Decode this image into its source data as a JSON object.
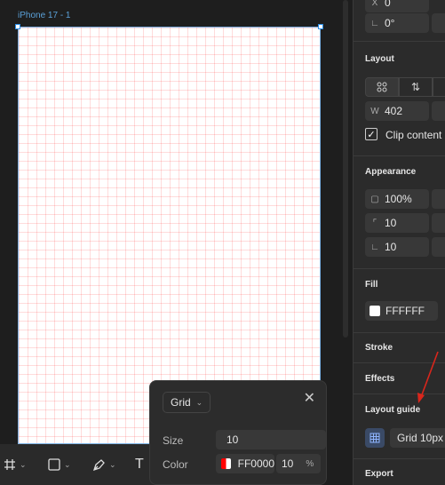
{
  "canvas": {
    "frame_label": "iPhone 17 - 1"
  },
  "toolbar": {
    "tools": [
      "frame-tool",
      "rectangle-tool",
      "pen-tool",
      "text-tool"
    ],
    "text_tool_glyph": "T"
  },
  "grid_popup": {
    "type_label": "Grid",
    "size_label": "Size",
    "size_value": "10",
    "color_label": "Color",
    "color_hex": "FF0000",
    "opacity_value": "10",
    "opacity_unit": "%",
    "grid_color": "#ff0000"
  },
  "panel": {
    "top": {
      "x_label": "X",
      "x_value": "0",
      "rotation_value": "0°"
    },
    "layout": {
      "title": "Layout",
      "width_label": "W",
      "width_value": "402",
      "clip_content_label": "Clip content",
      "clip_content_checked": true
    },
    "appearance": {
      "title": "Appearance",
      "opacity_value": "100%",
      "radius_value": "10",
      "radius_value_2": "10"
    },
    "fill": {
      "title": "Fill",
      "hex": "FFFFFF",
      "color": "#ffffff"
    },
    "stroke": {
      "title": "Stroke"
    },
    "effects": {
      "title": "Effects"
    },
    "layout_guide": {
      "title": "Layout guide",
      "item_label": "Grid 10px"
    },
    "export": {
      "title": "Export"
    }
  }
}
